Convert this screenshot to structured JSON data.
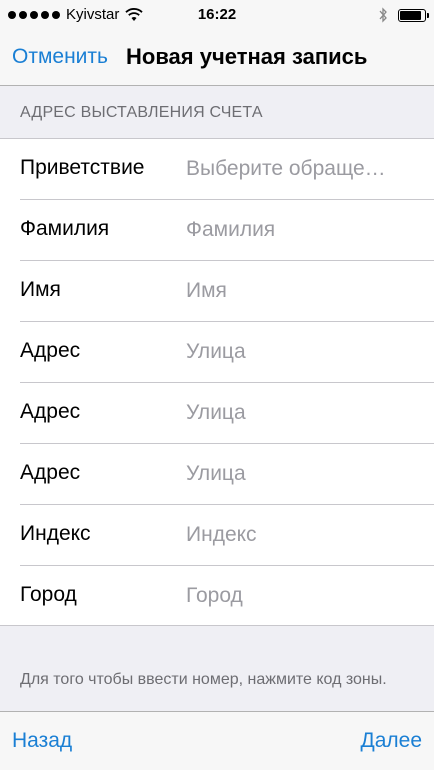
{
  "status_bar": {
    "carrier": "Kyivstar",
    "time": "16:22",
    "signal_bars_filled": 5,
    "battery_level": 0.9,
    "icons": [
      "signal-dots",
      "wifi-icon",
      "bluetooth-icon",
      "battery-icon"
    ]
  },
  "nav": {
    "cancel_label": "Отменить",
    "title": "Новая учетная запись"
  },
  "section": {
    "header": "АДРЕС ВЫСТАВЛЕНИЯ СЧЕТА"
  },
  "form": {
    "rows": [
      {
        "label": "Приветствие",
        "value": "",
        "placeholder": "Выберите обраще…"
      },
      {
        "label": "Фамилия",
        "value": "",
        "placeholder": "Фамилия"
      },
      {
        "label": "Имя",
        "value": "",
        "placeholder": "Имя"
      },
      {
        "label": "Адрес",
        "value": "",
        "placeholder": "Улица"
      },
      {
        "label": "Адрес",
        "value": "",
        "placeholder": "Улица"
      },
      {
        "label": "Адрес",
        "value": "",
        "placeholder": "Улица"
      },
      {
        "label": "Индекс",
        "value": "",
        "placeholder": "Индекс"
      },
      {
        "label": "Город",
        "value": "",
        "placeholder": "Город"
      }
    ]
  },
  "footer": {
    "note": "Для того чтобы ввести номер, нажмите код зоны."
  },
  "toolbar": {
    "back_label": "Назад",
    "next_label": "Далее"
  },
  "colors": {
    "accent": "#1a7fd4",
    "background": "#efeff4",
    "placeholder": "#9b9ba1",
    "secondary_text": "#6d6d72"
  }
}
